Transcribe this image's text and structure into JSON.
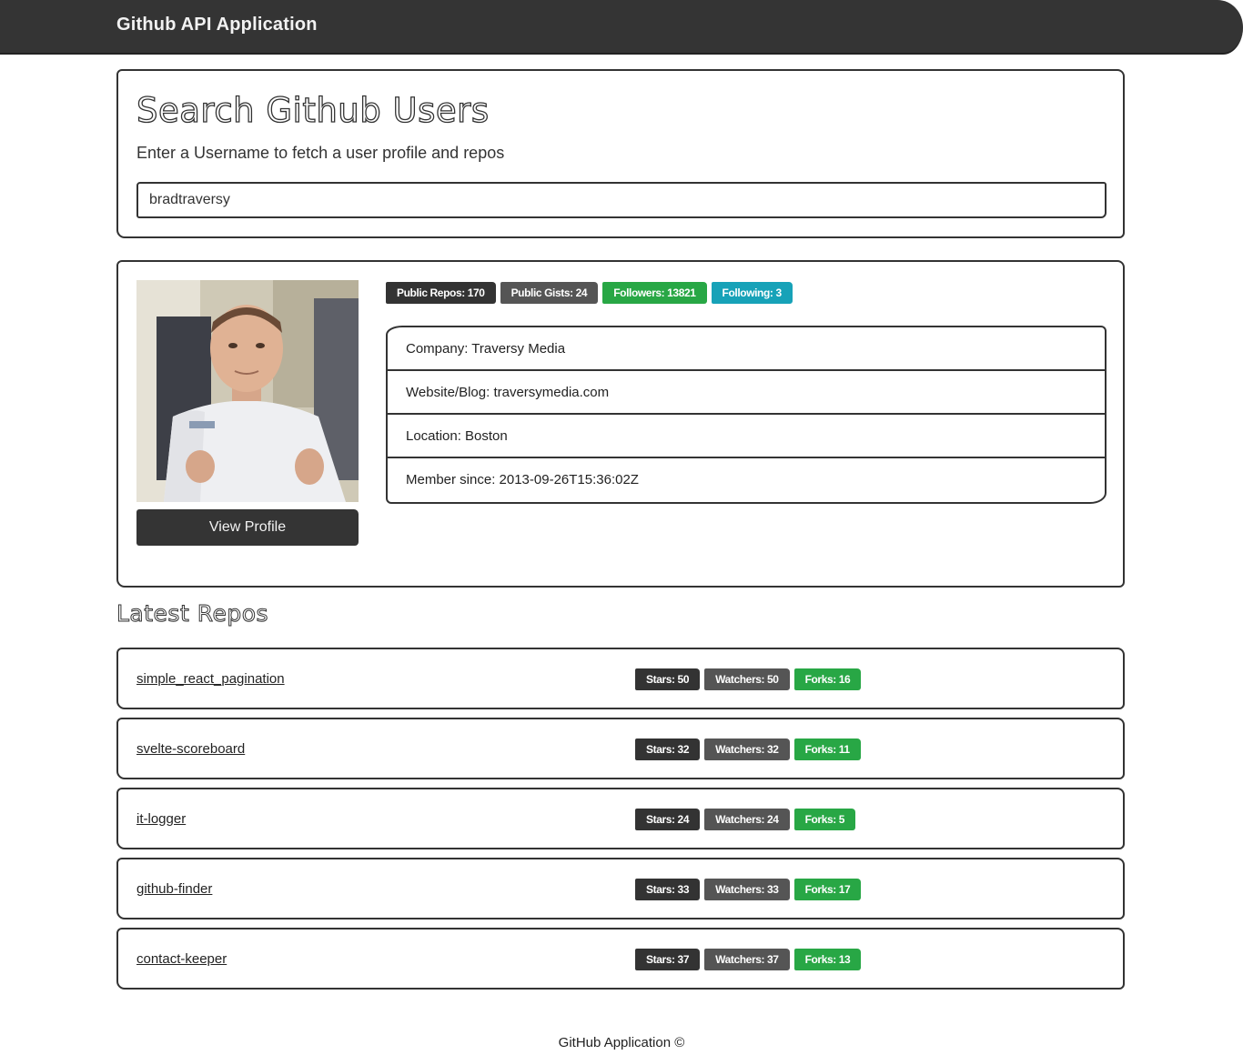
{
  "navbar": {
    "brand": "Github API Application"
  },
  "search": {
    "title": "Search Github Users",
    "subtitle": "Enter a Username to fetch a user profile and repos",
    "value": "bradtraversy"
  },
  "profile": {
    "view_profile_label": "View Profile",
    "badges": {
      "public_repos": "Public Repos: 170",
      "public_gists": "Public Gists: 24",
      "followers": "Followers: 13821",
      "following": "Following: 3"
    },
    "info": {
      "company": "Company: Traversy Media",
      "website": "Website/Blog: traversymedia.com",
      "location": "Location: Boston",
      "member_since": "Member since: 2013-09-26T15:36:02Z"
    }
  },
  "latest_repos_title": "Latest Repos",
  "repos": [
    {
      "name": "simple_react_pagination",
      "stars": "Stars: 50",
      "watchers": "Watchers: 50",
      "forks": "Forks: 16"
    },
    {
      "name": "svelte-scoreboard",
      "stars": "Stars: 32",
      "watchers": "Watchers: 32",
      "forks": "Forks: 11"
    },
    {
      "name": "it-logger",
      "stars": "Stars: 24",
      "watchers": "Watchers: 24",
      "forks": "Forks: 5"
    },
    {
      "name": "github-finder",
      "stars": "Stars: 33",
      "watchers": "Watchers: 33",
      "forks": "Forks: 17"
    },
    {
      "name": "contact-keeper",
      "stars": "Stars: 37",
      "watchers": "Watchers: 37",
      "forks": "Forks: 13"
    }
  ],
  "footer": "GitHub Application ©",
  "colors": {
    "navbar": "#343434",
    "badge_dark": "#333333",
    "badge_gray": "#555555",
    "badge_green": "#28a745",
    "badge_teal": "#17a2b8"
  }
}
